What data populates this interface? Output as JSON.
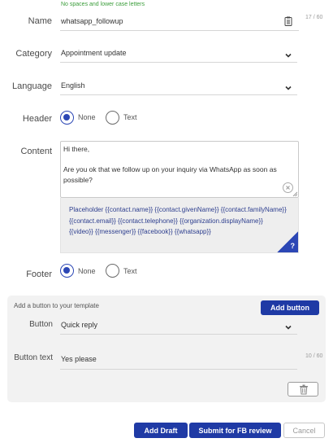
{
  "name_field": {
    "hint": "No spaces and lower case letters",
    "label": "Name",
    "value": "whatsapp_followup",
    "counter": "17 / 60"
  },
  "category": {
    "label": "Category",
    "value": "Appointment update"
  },
  "language": {
    "label": "Language",
    "value": "English"
  },
  "header": {
    "label": "Header",
    "options": [
      {
        "label": "None",
        "selected": true
      },
      {
        "label": "Text",
        "selected": false
      }
    ]
  },
  "content": {
    "label": "Content",
    "body": "Hi there,\n\nAre you ok that we follow up on your inquiry via WhatsApp as soon as possible?",
    "placeholder_text": "Placeholder {{contact.name}} {{contact.givenName}} {{contact.familyName}} {{contact.email}} {{contact.telephone}} {{organization.displayName}} {{video}} {{messenger}} {{facebook}} {{whatsapp}}",
    "help": "?"
  },
  "footer": {
    "label": "Footer",
    "options": [
      {
        "label": "None",
        "selected": true
      },
      {
        "label": "Text",
        "selected": false
      }
    ]
  },
  "buttons_panel": {
    "intro": "Add a button to your template",
    "add_button_label": "Add button",
    "button_label": "Button",
    "button_type": "Quick reply",
    "button_text_label": "Button text",
    "button_text_value": "Yes please",
    "button_text_counter": "10 / 60"
  },
  "actions": {
    "add_draft": "Add Draft",
    "submit": "Submit for FB review",
    "cancel": "Cancel"
  },
  "colors": {
    "accent": "#1f3aa5",
    "hint": "#3a9d3a",
    "panel": "#f2f2f2"
  }
}
